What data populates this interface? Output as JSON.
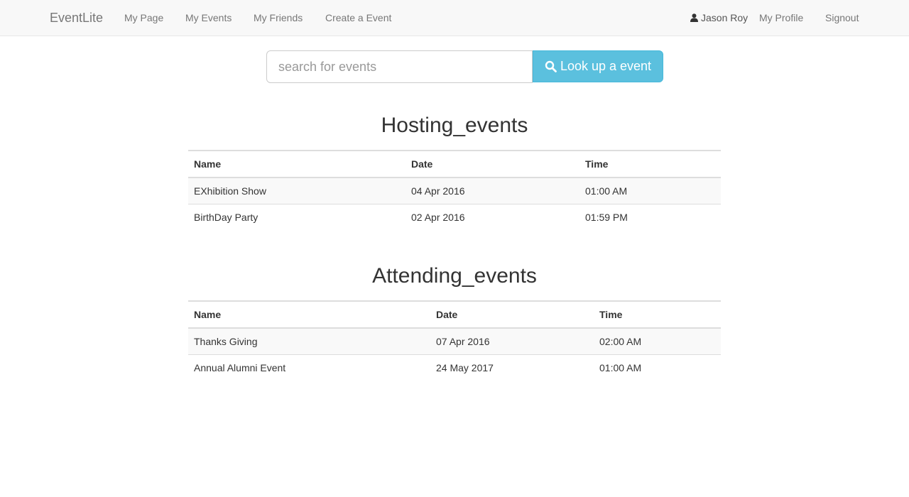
{
  "navbar": {
    "brand": "EventLite",
    "links": [
      "My Page",
      "My Events",
      "My Friends",
      "Create a Event"
    ],
    "user_name": "Jason Roy",
    "profile_label": "My Profile",
    "signout_label": "Signout"
  },
  "search": {
    "placeholder": "search for events",
    "value": "",
    "button_label": "Look up a event"
  },
  "hosting": {
    "title": "Hosting_events",
    "columns": [
      "Name",
      "Date",
      "Time"
    ],
    "rows": [
      [
        "EXhibition Show",
        "04 Apr 2016",
        "01:00 AM"
      ],
      [
        "BirthDay Party",
        "02 Apr 2016",
        "01:59 PM"
      ]
    ]
  },
  "attending": {
    "title": "Attending_events",
    "columns": [
      "Name",
      "Date",
      "Time"
    ],
    "rows": [
      [
        "Thanks Giving",
        "07 Apr 2016",
        "02:00 AM"
      ],
      [
        "Annual Alumni Event",
        "24 May 2017",
        "01:00 AM"
      ]
    ]
  },
  "colors": {
    "navbar_bg": "#f8f8f8",
    "button_info": "#5bc0de",
    "text": "#333333",
    "nav_text": "#777777"
  }
}
